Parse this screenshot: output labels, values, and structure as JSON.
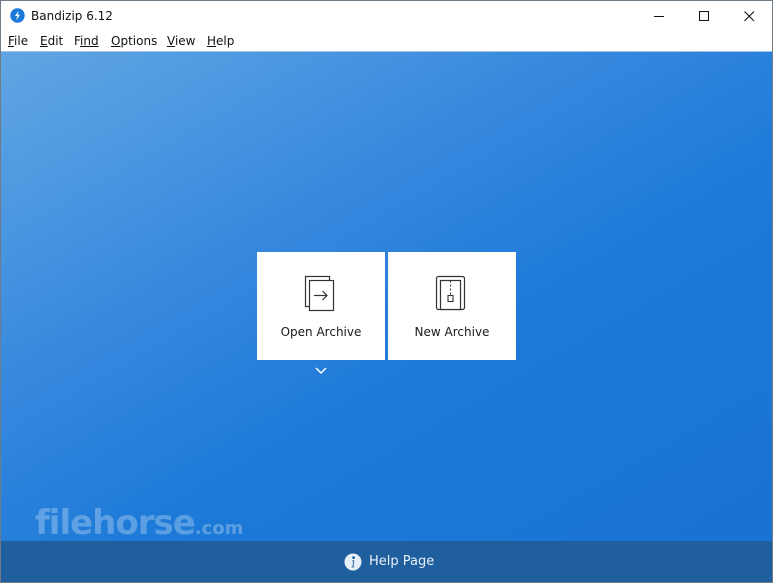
{
  "window": {
    "title": "Bandizip 6.12"
  },
  "menu": {
    "items": [
      {
        "label": "File",
        "accel": "F",
        "rest": "ile"
      },
      {
        "label": "Edit",
        "accel": "E",
        "rest": "dit"
      },
      {
        "label": "Find",
        "accel": "F",
        "pre": "",
        "rest": "ind"
      },
      {
        "label": "Options",
        "accel": "O",
        "rest": "ptions"
      },
      {
        "label": "View",
        "accel": "V",
        "rest": "iew"
      },
      {
        "label": "Help",
        "accel": "H",
        "rest": "elp"
      }
    ]
  },
  "tiles": {
    "open_label": "Open Archive",
    "new_label": "New Archive"
  },
  "watermark": {
    "text": "filehorse",
    "suffix": ".com"
  },
  "footer": {
    "help_label": "Help Page"
  },
  "colors": {
    "accent": "#1a72d2",
    "footer": "#1f5f9d"
  }
}
